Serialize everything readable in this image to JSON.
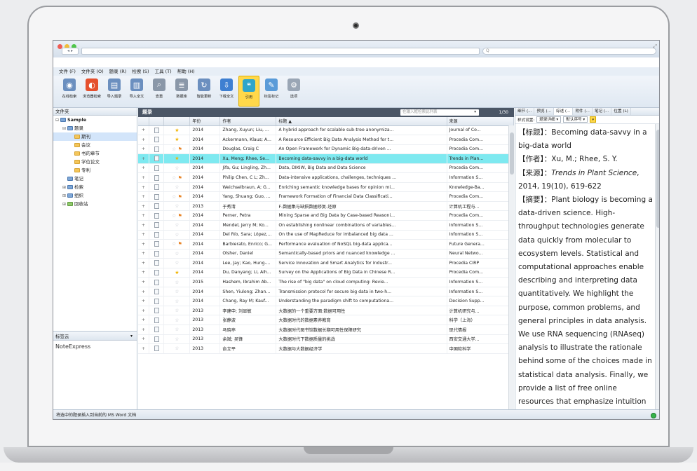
{
  "window": {
    "search_placeholder": "Q"
  },
  "menu": [
    "文件 (F)",
    "文件夹 (O)",
    "题录 (R)",
    "检索 (S)",
    "工具 (T)",
    "帮助 (H)"
  ],
  "toolbar": [
    {
      "label": "在线检索",
      "icon": "globe-search-icon",
      "color": "#6b8fbf"
    },
    {
      "label": "浏览器检索",
      "icon": "browser-icon",
      "color": "#e5502e"
    },
    {
      "label": "导入题录",
      "icon": "import-records-icon",
      "color": "#6b8fbf"
    },
    {
      "label": "导入全文",
      "icon": "import-fulltext-icon",
      "color": "#6b8fbf"
    },
    {
      "label": "查重",
      "icon": "dedupe-icon",
      "color": "#8a97a8"
    },
    {
      "label": "数据库",
      "icon": "database-icon",
      "color": "#8a97a8"
    },
    {
      "label": "智能更新",
      "icon": "smart-update-icon",
      "color": "#6b8fbf"
    },
    {
      "label": "下载全文",
      "icon": "download-fulltext-icon",
      "color": "#3e7fd1"
    },
    {
      "label": "引用",
      "icon": "cite-icon",
      "color": "#2fa5c9"
    },
    {
      "label": "标签标记",
      "icon": "tag-icon",
      "color": "#5a9bd8"
    },
    {
      "label": "选项",
      "icon": "options-icon",
      "color": "#9aa6b5"
    }
  ],
  "left": {
    "header": "文件夹",
    "tree": [
      {
        "label": "Sample",
        "toggle": "⊟",
        "depth": 0,
        "type": "root",
        "bold": true
      },
      {
        "label": "题录",
        "toggle": "⊟",
        "depth": 1,
        "type": "b"
      },
      {
        "label": "期刊",
        "toggle": "",
        "depth": 2,
        "type": "y",
        "selected": true
      },
      {
        "label": "会议",
        "toggle": "",
        "depth": 2,
        "type": "y"
      },
      {
        "label": "书的章节",
        "toggle": "",
        "depth": 2,
        "type": "y"
      },
      {
        "label": "学位论文",
        "toggle": "",
        "depth": 2,
        "type": "y"
      },
      {
        "label": "专利",
        "toggle": "",
        "depth": 2,
        "type": "y"
      },
      {
        "label": "笔记",
        "toggle": "",
        "depth": 1,
        "type": "b"
      },
      {
        "label": "检索",
        "toggle": "⊞",
        "depth": 1,
        "type": "b"
      },
      {
        "label": "组织",
        "toggle": "⊞",
        "depth": 1,
        "type": "b"
      },
      {
        "label": "回收站",
        "toggle": "⊞",
        "depth": 1,
        "type": "g"
      }
    ],
    "tagcloud_label": "标签云",
    "tag_word": "NoteExpress"
  },
  "center": {
    "title": "题录",
    "search_placeholder": "在输入框检索此列表",
    "page": "1/30",
    "columns": [
      "",
      "",
      "",
      "年份",
      "作者",
      "标题 ▲",
      "来源"
    ],
    "rows": [
      {
        "flag": false,
        "star": true,
        "year": "2014",
        "author": "Zhang, Xuyun; Liu, ...",
        "title": "A hybrid approach for scalable sub-tree anonymiza...",
        "source": "Journal of Co..."
      },
      {
        "flag": false,
        "star": true,
        "year": "2014",
        "author": "Ackermann, Klaus; A...",
        "title": "A Resource Efficient Big Data Analysis Method for t...",
        "source": "Procedia Com..."
      },
      {
        "flag": true,
        "star": false,
        "year": "2014",
        "author": "Douglas, Craig C",
        "title": "An Open Framework for Dynamic Big-data-driven ...",
        "source": "Procedia Com..."
      },
      {
        "flag": false,
        "star": true,
        "year": "2014",
        "author": "Xu, Meng; Rhee, Se...",
        "title": "Becoming data-savvy in a big-data world",
        "source": "Trends in Plan...",
        "highlight": true
      },
      {
        "flag": false,
        "star": false,
        "year": "2014",
        "author": "Jifa, Gu; Lingling, Zh...",
        "title": "Data, DIKIW, Big Data and Data Science",
        "source": "Procedia Com..."
      },
      {
        "flag": true,
        "star": false,
        "year": "2014",
        "author": "Philip Chen, C L; Zh...",
        "title": "Data-intensive applications, challenges, techniques ...",
        "source": "Information S..."
      },
      {
        "flag": false,
        "star": false,
        "year": "2014",
        "author": "Weichselbraun, A; G...",
        "title": "Enriching semantic knowledge bases for opinion mi...",
        "source": "Knowledge-Ba..."
      },
      {
        "flag": true,
        "star": false,
        "year": "2014",
        "author": "Yang, Shuang; Guo, ...",
        "title": "Framework Formation of Financial Data Classificati...",
        "source": "Procedia Com..."
      },
      {
        "flag": false,
        "star": false,
        "year": "2013",
        "author": "于秀清",
        "title": "F-数据集与缺损数据修复-还原",
        "source": "计算机工程与..."
      },
      {
        "flag": true,
        "star": false,
        "year": "2014",
        "author": "Perner, Petra",
        "title": "Mining Sparse and Big Data by Case-based Reasoni...",
        "source": "Procedia Com..."
      },
      {
        "flag": false,
        "star": false,
        "year": "2014",
        "author": "Mendel, Jerry M; Ko...",
        "title": "On establishing nonlinear combinations of variables...",
        "source": "Information S..."
      },
      {
        "flag": false,
        "star": false,
        "year": "2014",
        "author": "Del Río, Sara; López,...",
        "title": "On the use of MapReduce for imbalanced big data ...",
        "source": "Information S..."
      },
      {
        "flag": true,
        "star": false,
        "year": "2014",
        "author": "Barbierato, Enrico; G...",
        "title": "Performance evaluation of NoSQL big-data applica...",
        "source": "Future Genera..."
      },
      {
        "flag": false,
        "star": false,
        "year": "2014",
        "author": "Olsher, Daniel",
        "title": "Semantically-based priors and nuanced knowledge ...",
        "source": "Neural Netwo..."
      },
      {
        "flag": false,
        "star": false,
        "year": "2014",
        "author": "Lee, Jay; Kao, Hung-...",
        "title": "Service Innovation and Smart Analytics for Industr...",
        "source": "Procedia CIRP"
      },
      {
        "flag": false,
        "star": true,
        "year": "2014",
        "author": "Du, Danyang; Li, Aih...",
        "title": "Survey on the Applications of Big Data in Chinese R...",
        "source": "Procedia Com..."
      },
      {
        "flag": false,
        "star": false,
        "year": "2015",
        "author": "Hashem, Ibrahim Ab...",
        "title": "The rise of \"big data\" on cloud computing: Revie...",
        "source": "Information S..."
      },
      {
        "flag": false,
        "star": false,
        "year": "2014",
        "author": "Shen, Yiulong; Zhan...",
        "title": "Transmission protocol for secure big data in two-h...",
        "source": "Information S..."
      },
      {
        "flag": false,
        "star": false,
        "year": "2014",
        "author": "Chang, Ray M; Kauf...",
        "title": "Understanding the paradigm shift to computationa...",
        "source": "Decision Supp..."
      },
      {
        "flag": false,
        "star": false,
        "year": "2013",
        "author": "李建中; 刘显敏",
        "title": "大数据的一个重要方面:数据可用性",
        "source": "计算机研究与..."
      },
      {
        "flag": false,
        "star": false,
        "year": "2013",
        "author": "张静波",
        "title": "大数据时代的数据素养教育",
        "source": "科学（上海）"
      },
      {
        "flag": false,
        "star": false,
        "year": "2013",
        "author": "马晓亭",
        "title": "大数据时代图书馆数据长期可用性保障研究",
        "source": "现代情报"
      },
      {
        "flag": false,
        "star": false,
        "year": "2013",
        "author": "余斌; 吴锋",
        "title": "大数据时代下数据质量的挑战",
        "source": "西安交通大学..."
      },
      {
        "flag": false,
        "star": false,
        "year": "2013",
        "author": "俞立平",
        "title": "大数据与大数据经济学",
        "source": "中国软科学"
      }
    ]
  },
  "right": {
    "tabs": [
      "细节 (...",
      "预览 (...",
      "综述 (...",
      "附件 (...",
      "笔记 (...",
      "位置 (L)"
    ],
    "active_tab": 2,
    "style_label": "样式设置:",
    "style_value": "题录详细",
    "sort_label": "默认序号",
    "content": [
      {
        "label": "【标题】：",
        "text": "Becoming data-savvy in a big-data world",
        "italic": false
      },
      {
        "label": "【作者】：",
        "text": "Xu, M.; Rhee, S. Y.",
        "italic": false
      },
      {
        "label": "【来源】：",
        "text": "Trends in Plant Science",
        "italic": true,
        "suffix": ", 2014, 19(10), 619-622"
      },
      {
        "label": "【摘要】：",
        "text": "Plant biology is becoming a data-driven science. High-throughput technologies generate data quickly from molecular to ecosystem levels. Statistical and computational approaches enable describing and interpreting data quantitatively. We highlight the purpose, common problems, and general principles in data analysis. We use RNA sequencing (RNAseq) analysis to illustrate the rationale behind some of the choices made in statistical data analysis. Finally, we provide a list of free online resources that emphasize intuition behind",
        "italic": false
      }
    ]
  },
  "status": "将选中的题录插入到当前的 MS Word 文档"
}
